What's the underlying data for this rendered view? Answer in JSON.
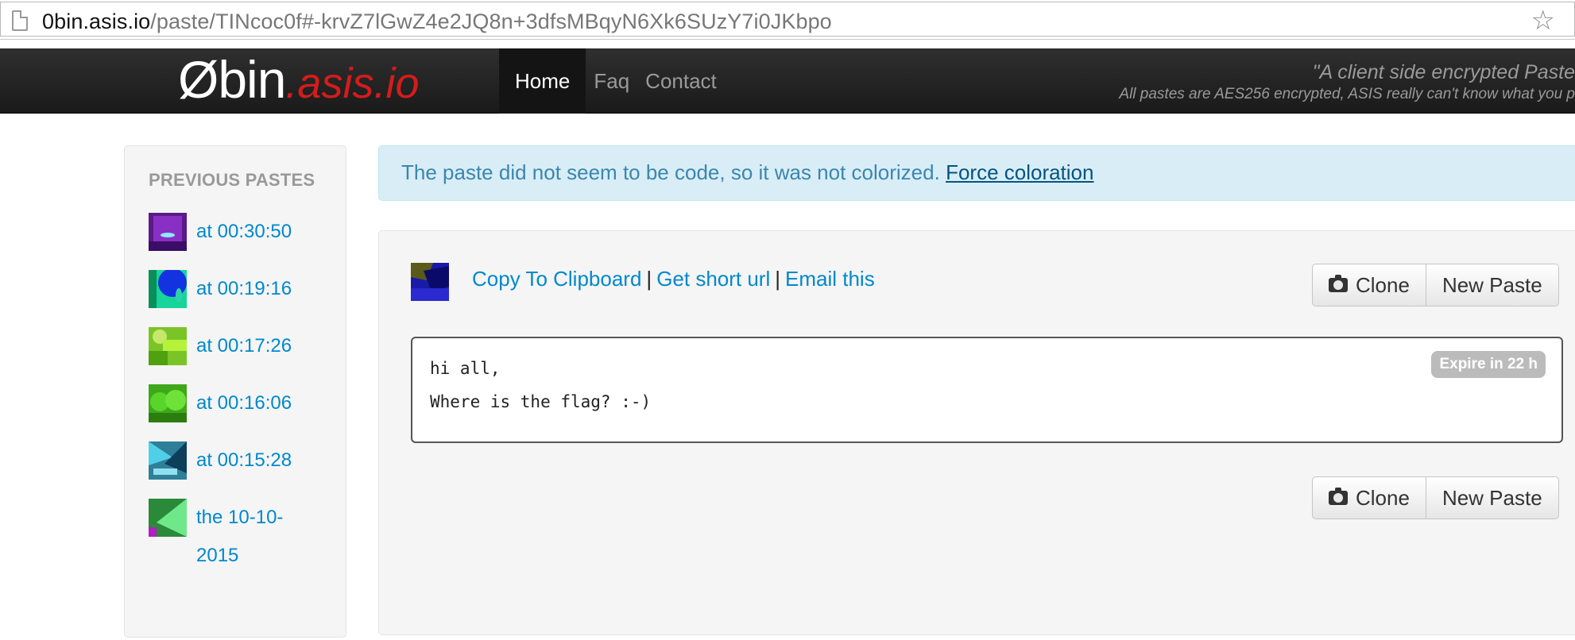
{
  "browser": {
    "url_host": "0bin.asis.io",
    "url_path": "/paste/TINcoc0f#-krvZ7lGwZ4e2JQ8n+3dfsMBqyN6Xk6SUzY7i0JKbpo",
    "icons": {
      "page": "page-icon",
      "bookmark": "star-icon"
    }
  },
  "navbar": {
    "brand_main": "Øbin",
    "brand_sub": ".asis.io",
    "brand_sub_color": "#d31c1c",
    "nav_items": [
      {
        "label": "Home",
        "active": true
      },
      {
        "label": "Faq",
        "active": false
      },
      {
        "label": "Contact",
        "active": false
      }
    ],
    "tagline_line1": "\"A client side encrypted Paste",
    "tagline_line2": "All pastes are AES256 encrypted, ASIS really can't know what you p"
  },
  "sidebar": {
    "title": "PREVIOUS PASTES",
    "pastes": [
      {
        "label": "at 00:30:50"
      },
      {
        "label": "at 00:19:16"
      },
      {
        "label": "at 00:17:26"
      },
      {
        "label": "at 00:16:06"
      },
      {
        "label": "at 00:15:28"
      },
      {
        "label": "the 10-10-2015"
      }
    ]
  },
  "alert": {
    "message": "The paste did not seem to be code, so it was not colorized.",
    "link": "Force coloration"
  },
  "paste": {
    "actions": {
      "copy": "Copy To Clipboard",
      "short_url": "Get short url",
      "email": "Email this",
      "separator": "|"
    },
    "buttons": {
      "clone": "Clone",
      "new_paste": "New Paste",
      "clone_icon": "camera-icon"
    },
    "content_lines": [
      "hi all,",
      "Where is the flag? :-)"
    ],
    "expire_label": "Expire in 22 h"
  },
  "colors": {
    "link": "#0088cc",
    "alert_bg": "#d9edf7",
    "alert_text": "#3a87ad",
    "navbar_bg": "#222222"
  }
}
